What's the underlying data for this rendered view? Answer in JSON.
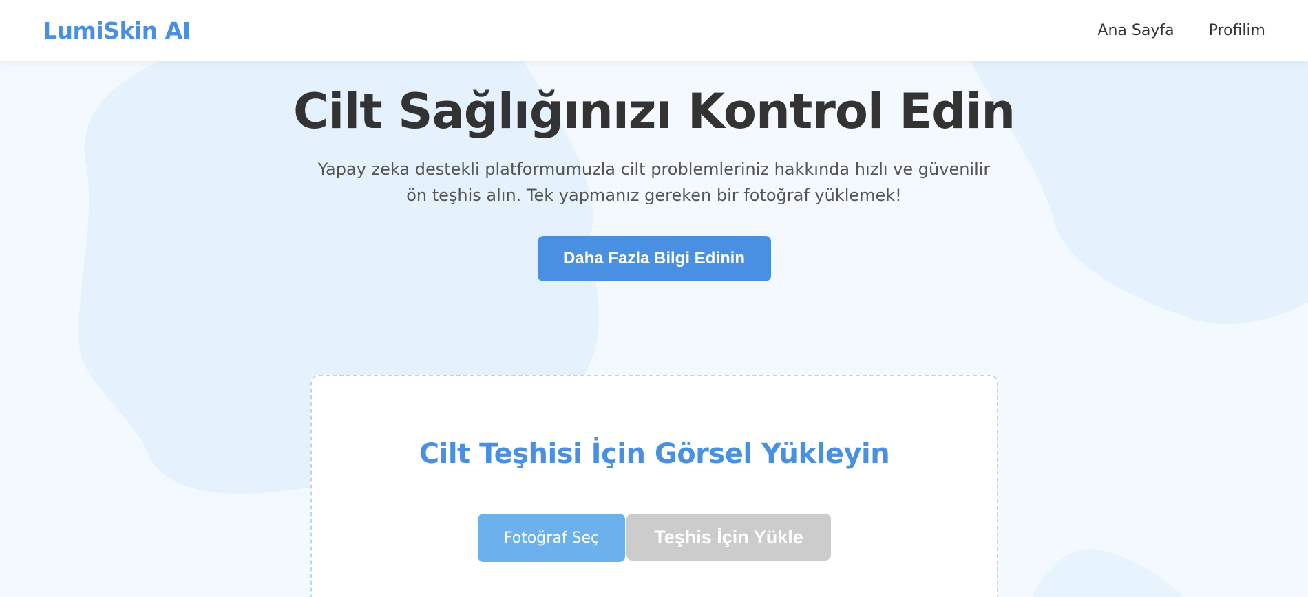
{
  "brand": {
    "name": "LumiSkin AI"
  },
  "nav": {
    "items": [
      "Ana Sayfa",
      "Profilim"
    ]
  },
  "hero": {
    "title": "Cilt Sağlığınızı Kontrol Edin",
    "subtitle": "Yapay zeka destekli platformumuzla cilt problemleriniz hakkında hızlı ve güvenilir ön teşhis alın. Tek yapmanız gereken bir fotoğraf yüklemek!",
    "cta_label": "Daha Fazla Bilgi Edinin"
  },
  "upload": {
    "title": "Cilt Teşhisi İçin Görsel Yükleyin",
    "select_label": "Fotoğraf Seç",
    "upload_label": "Teşhis İçin Yükle",
    "upload_enabled": false
  },
  "colors": {
    "accent": "#4a90e2",
    "select_button": "#6cb1ee",
    "disabled_button": "#cccccc",
    "blob": "#e3f1fd"
  }
}
